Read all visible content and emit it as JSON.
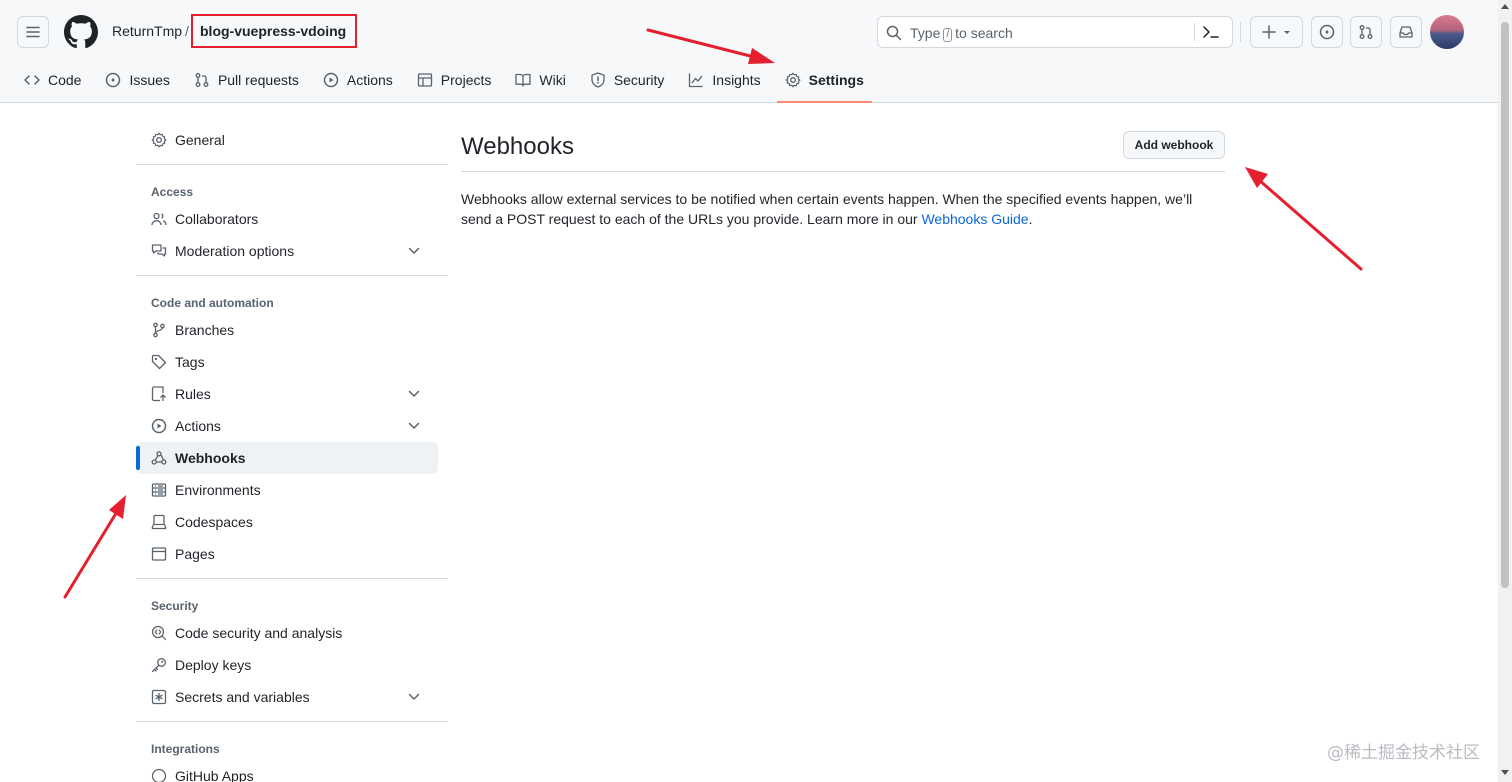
{
  "header": {
    "owner": "ReturnTmp",
    "separator": "/",
    "repo": "blog-vuepress-vdoing",
    "search": {
      "prefix": "Type",
      "key": "/",
      "suffix": "to search"
    }
  },
  "tabs": [
    {
      "label": "Code",
      "icon": "code-icon"
    },
    {
      "label": "Issues",
      "icon": "issue-icon"
    },
    {
      "label": "Pull requests",
      "icon": "pull-request-icon"
    },
    {
      "label": "Actions",
      "icon": "play-icon"
    },
    {
      "label": "Projects",
      "icon": "table-icon"
    },
    {
      "label": "Wiki",
      "icon": "book-icon"
    },
    {
      "label": "Security",
      "icon": "shield-icon"
    },
    {
      "label": "Insights",
      "icon": "graph-icon"
    },
    {
      "label": "Settings",
      "icon": "gear-icon",
      "active": true
    }
  ],
  "sidebar": {
    "general": "General",
    "access_heading": "Access",
    "access": [
      "Collaborators",
      "Moderation options"
    ],
    "code_heading": "Code and automation",
    "code": [
      "Branches",
      "Tags",
      "Rules",
      "Actions",
      "Webhooks",
      "Environments",
      "Codespaces",
      "Pages"
    ],
    "security_heading": "Security",
    "security": [
      "Code security and analysis",
      "Deploy keys",
      "Secrets and variables"
    ],
    "integrations_heading": "Integrations",
    "integrations": [
      "GitHub Apps"
    ]
  },
  "main": {
    "title": "Webhooks",
    "add_button": "Add webhook",
    "description_1": "Webhooks allow external services to be notified when certain events happen. When the specified events happen, we’ll send a POST request to each of the URLs you provide. Learn more in our ",
    "link": "Webhooks Guide",
    "description_2": "."
  },
  "watermark": "@稀土掘金技术社区",
  "colors": {
    "accent": "#0969da",
    "tab_underline": "#fd8c73",
    "annotation": "#e5202e",
    "header_bg": "#f6f8fa"
  }
}
